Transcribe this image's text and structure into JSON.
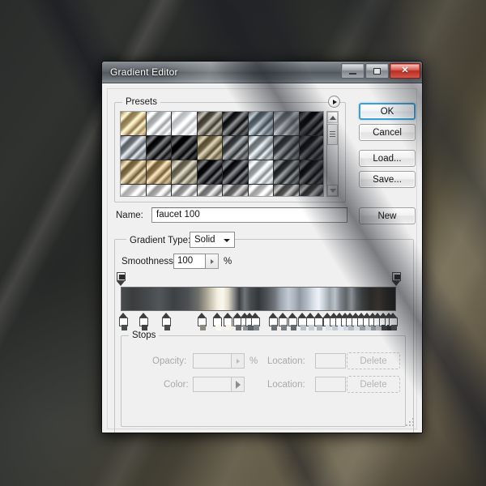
{
  "window": {
    "title": "Gradient Editor",
    "controls": {
      "minimize": "minimize-button",
      "maximize": "maximize-button",
      "close": "✕"
    }
  },
  "presets": {
    "legend": "Presets",
    "flyout_icon": "play-triangle-icon",
    "scrollbar": {
      "up_icon": "arrow-up-icon",
      "down_icon": "arrow-down-icon"
    },
    "swatches": [
      "#c0a97e",
      "#cfd3d6",
      "#e9ecef",
      "#6f6b5e",
      "#3a3c3e",
      "#7e8a92",
      "#a9b0b4",
      "#1d1f20",
      "#8e949a",
      "#2a2c2e",
      "#17181a",
      "#8b7f63",
      "#5c5f62",
      "#9aa1a6",
      "#595d60",
      "#2e3032",
      "#a08e69",
      "#a6906a",
      "#8d8876",
      "#24262a",
      "#33373b",
      "#b9bfc3",
      "#4c5052",
      "#2b2d2f",
      "#dedede",
      "#c9c9c9",
      "#b5b5b5",
      "#9d9d9d",
      "#888888",
      "#d2d2d2",
      "#747474",
      "#5e5e5e"
    ]
  },
  "name": {
    "label": "Name:",
    "value": "faucet 100"
  },
  "buttons": {
    "ok": "OK",
    "cancel": "Cancel",
    "load": "Load...",
    "save": "Save...",
    "new": "New"
  },
  "gradient_type": {
    "label": "Gradient Type:",
    "value": "Solid",
    "caret_icon": "chevron-down-icon"
  },
  "smoothness": {
    "label": "Smoothness:",
    "value": "100",
    "unit": "%",
    "stepper_icon": "stepper-triangle-icon"
  },
  "gradient": {
    "css": "linear-gradient(to right, #4a4d4e 0%, #3a3c3d 4%, #45484a 9%, #52565a 14%, #3e4143 19%, #4b4f52 24%, #6d6f6a 28%, #a9a394 31%, #cfc9b6 33%, #f2eee0 35%, #fbf8ee 37%, #ded9c8 39%, #8e8f8c 41%, #3c4042 43%, #70757a 45%, #4a4e52 47%, #33373a 50%, #4d5257 53%, #6f757b 56%, #9aa3ac 58%, #c2cbd4 61%, #aeb7c0 63%, #8f98a2 65%, #b6bfc8 68%, #d6dee6 70%, #eef3f8 72%, #c7ced6 74%, #9aa2aa 76%, #b9c1c9 78%, #7d848b 80%, #5e6468 82%, #8a9096 84%, #555a5e 86%, #3c3f40 88%, #2e2c29 91%, #3d382f 94%, #2a2723 97%, #201e1b 100%)",
    "opacity_stops": [
      {
        "pos": 0
      },
      {
        "pos": 100
      }
    ],
    "color_stops": [
      {
        "pos": 1.0,
        "color": "#4a4d4e"
      },
      {
        "pos": 8.5,
        "color": "#3f4244"
      },
      {
        "pos": 16.5,
        "color": "#4a4d4f"
      },
      {
        "pos": 29.5,
        "color": "#8d8c7c"
      },
      {
        "pos": 35.0,
        "color": "#fdfbf2"
      },
      {
        "pos": 39.0,
        "color": "#f7f3e6"
      },
      {
        "pos": 42.5,
        "color": "#6b6f72"
      },
      {
        "pos": 45.0,
        "color": "#8f949a"
      },
      {
        "pos": 47.0,
        "color": "#5d6267"
      },
      {
        "pos": 49.0,
        "color": "#7e858b"
      },
      {
        "pos": 55.5,
        "color": "#6a7075"
      },
      {
        "pos": 59.0,
        "color": "#7a8087"
      },
      {
        "pos": 62.5,
        "color": "#64696d"
      },
      {
        "pos": 66.0,
        "color": "#b9c2ca"
      },
      {
        "pos": 69.0,
        "color": "#c8d0d8"
      },
      {
        "pos": 72.0,
        "color": "#aab3bb"
      },
      {
        "pos": 75.0,
        "color": "#d9e0e7"
      },
      {
        "pos": 77.5,
        "color": "#c3ccd4"
      },
      {
        "pos": 79.5,
        "color": "#e4eaf0"
      },
      {
        "pos": 81.5,
        "color": "#cfd6dd"
      },
      {
        "pos": 83.5,
        "color": "#b4bcc3"
      },
      {
        "pos": 85.5,
        "color": "#d8dee4"
      },
      {
        "pos": 87.5,
        "color": "#9aa1a7"
      },
      {
        "pos": 89.5,
        "color": "#c6ccd2"
      },
      {
        "pos": 91.5,
        "color": "#8b9197"
      },
      {
        "pos": 93.5,
        "color": "#aeb4ba"
      },
      {
        "pos": 95.5,
        "color": "#3c3f41"
      },
      {
        "pos": 97.5,
        "color": "#2c2f31"
      },
      {
        "pos": 99.0,
        "color": "#4d5052"
      }
    ]
  },
  "stops": {
    "legend": "Stops",
    "opacity_label": "Opacity:",
    "opacity_value": "",
    "opacity_unit": "%",
    "opacity_location_label": "Location:",
    "opacity_location_value": "",
    "opacity_location_unit": "%",
    "opacity_delete": "Delete",
    "color_label": "Color:",
    "color_value": "",
    "color_picker_icon": "color-picker-arrow-icon",
    "color_location_label": "Location:",
    "color_location_value": "",
    "color_location_unit": "%",
    "color_delete": "Delete"
  }
}
